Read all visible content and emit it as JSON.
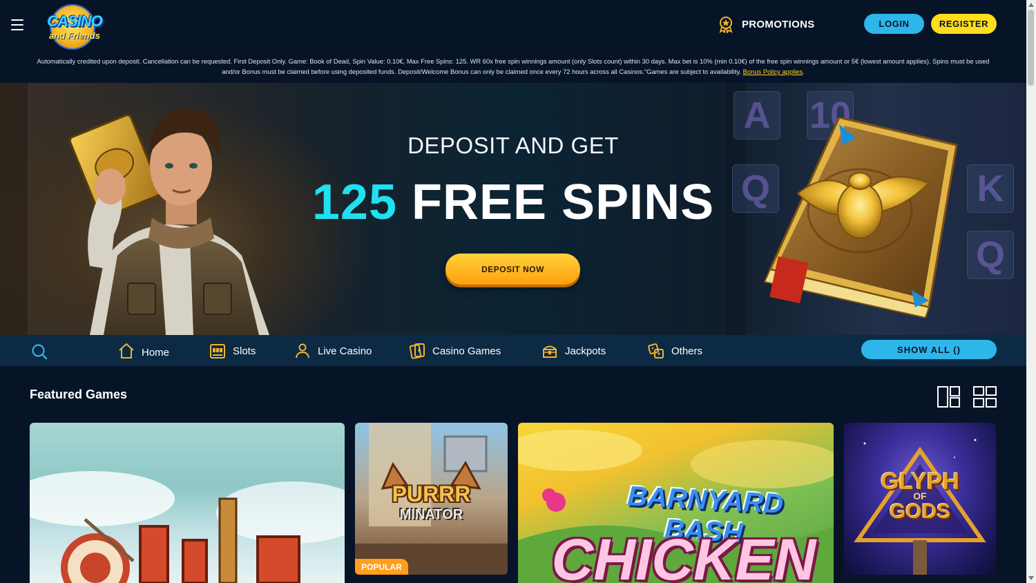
{
  "header": {
    "logo_top": "CASINO",
    "logo_bottom": "and Friends",
    "promotions_label": "PROMOTIONS",
    "login_label": "LOGIN",
    "register_label": "REGISTER"
  },
  "terms": {
    "text": "Automatically credited upon deposit. Cancellation can be requested. First Deposit Only. Game: Book of Dead, Spin Value: 0.10€, Max Free Spins: 125. WR 60x free spin winnings amount (only Slots count) within 30 days. Max bet is 10% (min 0.10€) of the free spin winnings amount or 5€ (lowest amount applies). Spins must be used and/or Bonus must be claimed before using deposited funds. Deposit/Welcome Bonus can only be claimed once every 72 hours across all Casinos.\"Games are subject to availability.",
    "link": "Bonus Policy applies"
  },
  "hero": {
    "line1": "DEPOSIT AND GET",
    "number": "125",
    "line2": "FREE SPINS",
    "cta": "DEPOSIT NOW",
    "tiles": [
      "A",
      "10",
      "Q",
      "K",
      "Q"
    ]
  },
  "nav": {
    "items": [
      {
        "label": "Home"
      },
      {
        "label": "Slots"
      },
      {
        "label": "Live Casino"
      },
      {
        "label": "Casino Games"
      },
      {
        "label": "Jackpots"
      },
      {
        "label": "Others"
      }
    ],
    "show_all": "SHOW ALL ()"
  },
  "featured": {
    "title": "Featured Games",
    "games": [
      {
        "name": ""
      },
      {
        "name_line1": "PURRR",
        "name_line2": "MINATOR",
        "badge": "POPULAR"
      },
      {
        "name_line1": "BARNYARD BASH",
        "name_line2": "CHICKEN"
      },
      {
        "name_line1": "GLYPH",
        "name_of": "OF",
        "name_line2": "GODS"
      }
    ]
  },
  "colors": {
    "background": "#071428",
    "accent_cyan": "#2db6ea",
    "accent_yellow": "#ffdd1d",
    "hero_number": "#1fe1f0",
    "cta_orange": "#ffa10f",
    "nav_bar": "#0c2a44"
  },
  "icons": {
    "menu": "hamburger-menu-icon",
    "promotions": "award-badge-icon",
    "search": "search-icon",
    "home": "home-icon",
    "slots": "slot-machine-icon",
    "live_casino": "person-icon",
    "casino_games": "cards-icon",
    "jackpots": "treasure-icon",
    "others": "dice-icon",
    "layout_1": "layout-mixed-icon",
    "layout_2": "layout-grid-icon"
  }
}
